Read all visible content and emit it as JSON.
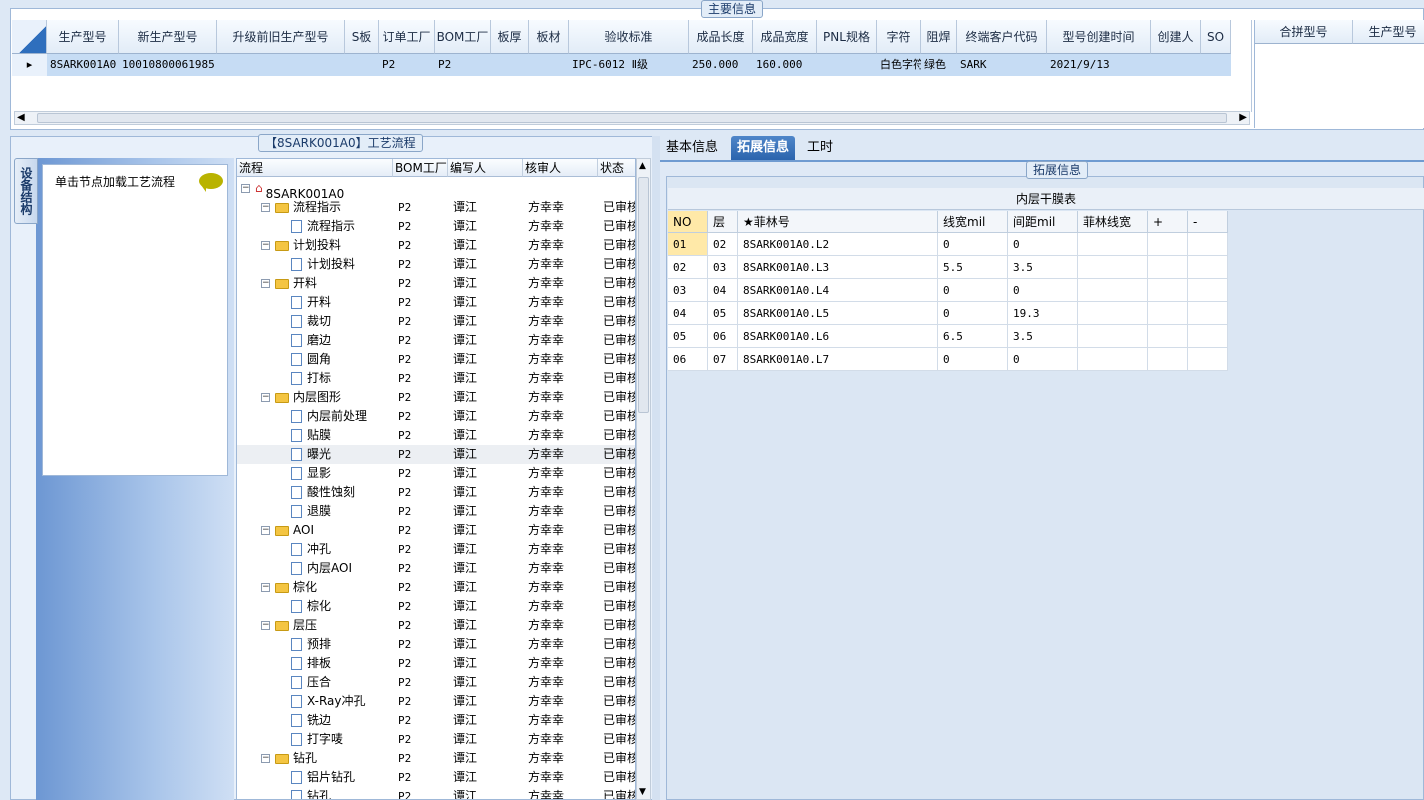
{
  "main_info": {
    "title": "主要信息",
    "columns": [
      "生产型号",
      "新生产型号",
      "升级前旧生产型号",
      "S板",
      "订单工厂",
      "BOM工厂",
      "板厚",
      "板材",
      "验收标准",
      "成品长度",
      "成品宽度",
      "PNL规格",
      "字符",
      "阻焊",
      "终端客户代码",
      "型号创建时间",
      "创建人",
      "SO"
    ],
    "row": {
      "c0": "8SARK001A0",
      "c1": "10010800061985",
      "c2": "",
      "c3": "",
      "c4": "P2",
      "c5": "P2",
      "c6": "",
      "c7": "",
      "c8": "IPC-6012 Ⅱ级",
      "c9": "250.000",
      "c10": "160.000",
      "c11": "",
      "c12": "白色字符",
      "c13": "绿色",
      "c14": "SARK",
      "c15": "2021/9/13",
      "c16": "",
      "c17": ""
    },
    "right_columns": [
      "合拼型号",
      "生产型号"
    ]
  },
  "flow": {
    "title": "【8SARK001A0】工艺流程",
    "side_tab": "设备结构",
    "hint": "单击节点加载工艺流程",
    "columns": [
      "流程",
      "BOM工厂",
      "编写人",
      "核审人",
      "状态"
    ],
    "rows": [
      {
        "name": "8SARK001A0",
        "bom": "",
        "writer": "",
        "checker": "",
        "status": ""
      },
      {
        "name": "流程指示",
        "bom": "P2",
        "writer": "谭江",
        "checker": "方幸幸",
        "status": "已审核"
      },
      {
        "name": "流程指示",
        "bom": "P2",
        "writer": "谭江",
        "checker": "方幸幸",
        "status": "已审核"
      },
      {
        "name": "计划投料",
        "bom": "P2",
        "writer": "谭江",
        "checker": "方幸幸",
        "status": "已审核"
      },
      {
        "name": "计划投料",
        "bom": "P2",
        "writer": "谭江",
        "checker": "方幸幸",
        "status": "已审核"
      },
      {
        "name": "开料",
        "bom": "P2",
        "writer": "谭江",
        "checker": "方幸幸",
        "status": "已审核"
      },
      {
        "name": "开料",
        "bom": "P2",
        "writer": "谭江",
        "checker": "方幸幸",
        "status": "已审核"
      },
      {
        "name": "裁切",
        "bom": "P2",
        "writer": "谭江",
        "checker": "方幸幸",
        "status": "已审核"
      },
      {
        "name": "磨边",
        "bom": "P2",
        "writer": "谭江",
        "checker": "方幸幸",
        "status": "已审核"
      },
      {
        "name": "圆角",
        "bom": "P2",
        "writer": "谭江",
        "checker": "方幸幸",
        "status": "已审核"
      },
      {
        "name": "打标",
        "bom": "P2",
        "writer": "谭江",
        "checker": "方幸幸",
        "status": "已审核"
      },
      {
        "name": "内层图形",
        "bom": "P2",
        "writer": "谭江",
        "checker": "方幸幸",
        "status": "已审核"
      },
      {
        "name": "内层前处理",
        "bom": "P2",
        "writer": "谭江",
        "checker": "方幸幸",
        "status": "已审核"
      },
      {
        "name": "贴膜",
        "bom": "P2",
        "writer": "谭江",
        "checker": "方幸幸",
        "status": "已审核"
      },
      {
        "name": "曝光",
        "bom": "P2",
        "writer": "谭江",
        "checker": "方幸幸",
        "status": "已审核"
      },
      {
        "name": "显影",
        "bom": "P2",
        "writer": "谭江",
        "checker": "方幸幸",
        "status": "已审核"
      },
      {
        "name": "酸性蚀刻",
        "bom": "P2",
        "writer": "谭江",
        "checker": "方幸幸",
        "status": "已审核"
      },
      {
        "name": "退膜",
        "bom": "P2",
        "writer": "谭江",
        "checker": "方幸幸",
        "status": "已审核"
      },
      {
        "name": "AOI",
        "bom": "P2",
        "writer": "谭江",
        "checker": "方幸幸",
        "status": "已审核"
      },
      {
        "name": "冲孔",
        "bom": "P2",
        "writer": "谭江",
        "checker": "方幸幸",
        "status": "已审核"
      },
      {
        "name": "内层AOI",
        "bom": "P2",
        "writer": "谭江",
        "checker": "方幸幸",
        "status": "已审核"
      },
      {
        "name": "棕化",
        "bom": "P2",
        "writer": "谭江",
        "checker": "方幸幸",
        "status": "已审核"
      },
      {
        "name": "棕化",
        "bom": "P2",
        "writer": "谭江",
        "checker": "方幸幸",
        "status": "已审核"
      },
      {
        "name": "层压",
        "bom": "P2",
        "writer": "谭江",
        "checker": "方幸幸",
        "status": "已审核"
      },
      {
        "name": "预排",
        "bom": "P2",
        "writer": "谭江",
        "checker": "方幸幸",
        "status": "已审核"
      },
      {
        "name": "排板",
        "bom": "P2",
        "writer": "谭江",
        "checker": "方幸幸",
        "status": "已审核"
      },
      {
        "name": "压合",
        "bom": "P2",
        "writer": "谭江",
        "checker": "方幸幸",
        "status": "已审核"
      },
      {
        "name": "X-Ray冲孔",
        "bom": "P2",
        "writer": "谭江",
        "checker": "方幸幸",
        "status": "已审核"
      },
      {
        "name": "铣边",
        "bom": "P2",
        "writer": "谭江",
        "checker": "方幸幸",
        "status": "已审核"
      },
      {
        "name": "打字唛",
        "bom": "P2",
        "writer": "谭江",
        "checker": "方幸幸",
        "status": "已审核"
      },
      {
        "name": "钻孔",
        "bom": "P2",
        "writer": "谭江",
        "checker": "方幸幸",
        "status": "已审核"
      },
      {
        "name": "铝片钻孔",
        "bom": "P2",
        "writer": "谭江",
        "checker": "方幸幸",
        "status": "已审核"
      },
      {
        "name": "钻孔",
        "bom": "P2",
        "writer": "谭江",
        "checker": "方幸幸",
        "status": "已审核"
      }
    ]
  },
  "tabs": [
    "基本信息",
    "拓展信息",
    "工时"
  ],
  "ext": {
    "group_title": "拓展信息",
    "table_title": "内层干膜表",
    "columns": [
      "NO",
      "层",
      "★菲林号",
      "线宽mil",
      "间距mil",
      "菲林线宽",
      "+",
      "-"
    ],
    "rows": [
      {
        "no": "01",
        "layer": "02",
        "film": "8SARK001A0.L2",
        "width": "0",
        "gap": "0",
        "fw": ""
      },
      {
        "no": "02",
        "layer": "03",
        "film": "8SARK001A0.L3",
        "width": "5.5",
        "gap": "3.5",
        "fw": ""
      },
      {
        "no": "03",
        "layer": "04",
        "film": "8SARK001A0.L4",
        "width": "0",
        "gap": "0",
        "fw": ""
      },
      {
        "no": "04",
        "layer": "05",
        "film": "8SARK001A0.L5",
        "width": "0",
        "gap": "19.3",
        "fw": ""
      },
      {
        "no": "05",
        "layer": "06",
        "film": "8SARK001A0.L6",
        "width": "6.5",
        "gap": "3.5",
        "fw": ""
      },
      {
        "no": "06",
        "layer": "07",
        "film": "8SARK001A0.L7",
        "width": "0",
        "gap": "0",
        "fw": ""
      }
    ]
  },
  "colors": {
    "selected_row": "#c6dcf4",
    "tab_active": "#2b64ad",
    "no_cell": "#ffe9a8",
    "folder": "#f4c542",
    "hint_bubble": "#b9b300"
  }
}
